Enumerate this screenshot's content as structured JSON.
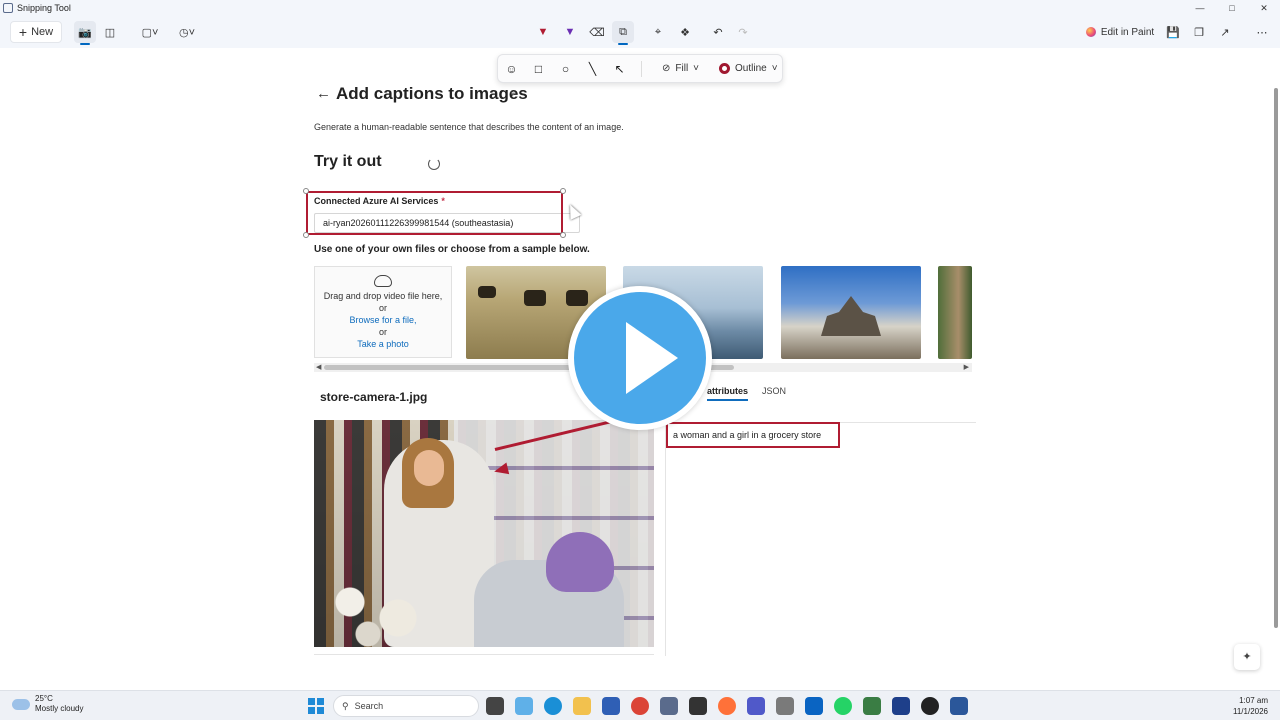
{
  "window": {
    "title": "Snipping Tool"
  },
  "toolbar": {
    "new_label": "New",
    "edit_in_paint_label": "Edit in Paint"
  },
  "shape_bar": {
    "fill_label": "Fill",
    "outline_label": "Outline"
  },
  "page": {
    "title": "Add captions to images",
    "description": "Generate a human-readable sentence that describes the content of an image.",
    "try_title": "Try it out",
    "service_label": "Connected Azure AI Services",
    "service_required": "*",
    "service_value": "ai-ryan20260111226399981544 (southeastasia)",
    "use_files": "Use one of your own files or choose from a sample below.",
    "drop": {
      "line1": "Drag and drop video file here,",
      "or1": "or",
      "browse": "Browse for a file,",
      "or2": "or",
      "photo": "Take a photo"
    },
    "filename": "store-camera-1.jpg",
    "tabs": {
      "attributes": "attributes",
      "json": "JSON"
    },
    "caption": "a woman and a girl in a grocery store"
  },
  "taskbar": {
    "weather_temp": "25°C",
    "weather_desc": "Mostly cloudy",
    "search_placeholder": "Search",
    "time": "1:07 am",
    "date": "11/1/2026"
  },
  "colors": {
    "annotation_red": "#b01c32",
    "play_blue": "#4aa8ea",
    "link_blue": "#0f6cbd"
  }
}
